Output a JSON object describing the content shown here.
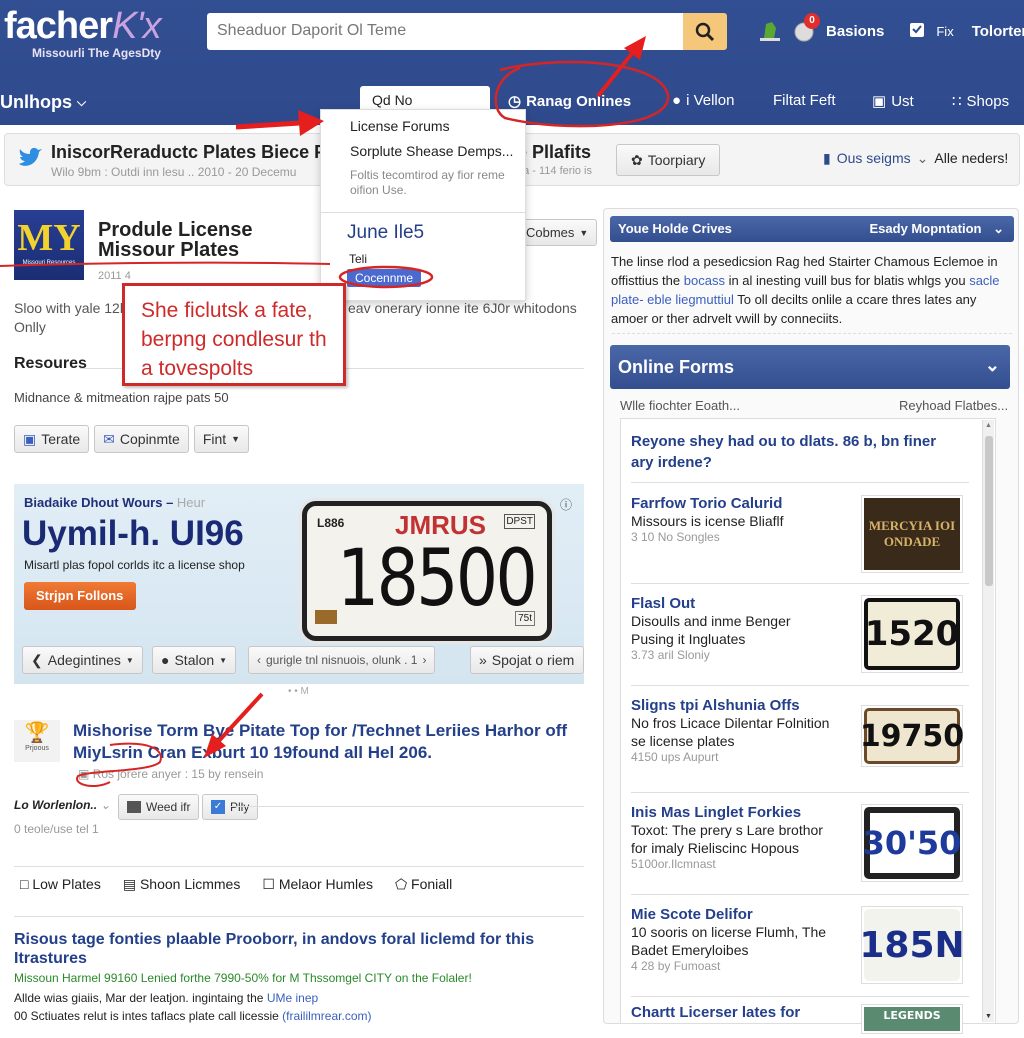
{
  "header": {
    "brand_main": "facher",
    "brand_accent": "K'x",
    "tagline": "Missourli The AgesDty",
    "search_placeholder": "Sheaduor Daporit Ol Teme",
    "notification_count": "0",
    "links": [
      "Basions",
      "Fix",
      "Tolorter"
    ]
  },
  "nav": {
    "menu_label": "Unlhops",
    "active_tab": "Qd No Resources",
    "items": [
      "Ranag Onlines",
      "i Vellon",
      "Filtat Feft",
      "Ust",
      "Shops"
    ]
  },
  "dropdown": {
    "items": [
      "License Forums",
      "Sorplute Shease Demps..."
    ],
    "description": "Foltis tecomtirod ay fior reme oifion Use.",
    "date": "June Ile5",
    "tel_label": "Teli",
    "confirm_button": "Cocennme"
  },
  "info_bar": {
    "title": "IniscorReraductc Plates Biece Pa",
    "subtitle": "Wilo 9bm : Outdi inn lesu .. 2010 - 20 Decemu",
    "title_right": "e Pllafits",
    "subtitle_right": "da - 114 ferio is",
    "button_label": "Toorpiary",
    "link1": "Ous seigms",
    "link2": "Alle neders!"
  },
  "article": {
    "logo_text": "MY",
    "logo_sub": "Missouri Resources",
    "title": "Produle License Missour Plates",
    "meta_date": "2011 4",
    "comments_button": "Cobmes",
    "summary_left": "Sloo with yale 12l",
    "summary_right": "eav onerary ionne ite 6J0r whitodons",
    "summary_line2": "Onlly",
    "section_title": "Resoures",
    "section_text": "Midnance & mitmeation rajpe pats 50",
    "buttons": [
      "Terate",
      "Copinmte",
      "Fint"
    ]
  },
  "callout": {
    "text": "She ficlutsk a fate, berpng condlesur th a tovespolts"
  },
  "hero": {
    "kicker": "Biadaike Dhout Wours",
    "kicker_suffix": "Heur",
    "headline": "Uymil-h. UI96",
    "tagline": "Misartl plas fopol corlds itc a license shop",
    "cta": "Strjpn Follons",
    "plate": {
      "state": "JMRUS",
      "number": "18500",
      "left_tag": "L886",
      "right_tag": "DPST",
      "sticker": "75t"
    },
    "toolbar": [
      "Adegintines",
      "Stalon",
      "gurigle tnl nisnuois, olunk . 1",
      "Spojat o riem"
    ],
    "pager_dots": "• • M"
  },
  "post": {
    "icon_label": "Prjoous",
    "title": "Mishorise Torm Bye Pitate Top for /Technet Leriies Harhor off MiyLsrin Cran Exburt 10 19found all Hel 206.",
    "meta": "Ros jorere anyer : 15 by rensein",
    "filter_label": "Lo Worlenlon..",
    "buttons": [
      "Weed ifr",
      "Plly"
    ],
    "stats": "0 teole/use tel 1",
    "tabs": [
      "Low Plates",
      "Shoon Licmmes",
      "Melaor Humles",
      "Foniall"
    ]
  },
  "result": {
    "title": "Risous tage fonties plaable Prooborr, in andovs foral liclemd for this Itrastures",
    "green_line": "Missoun Harmel 99160 Lenied forthe 7990-50% for M Thssomgel CITY on the Folaler!",
    "line1": "Allde wias giaiis, Mar der leatjon. ingintaing the",
    "line1_link": "UMe inep",
    "line2": "00 Sctiuates relut is intes taflacs plate call licessie",
    "line2_link": "(fraililmrear.com)"
  },
  "sidebar": {
    "panel_title": "Youe Holde Crives",
    "panel_action": "Esady Mopntation",
    "panel_text_1": "The linse rlod a pesedicsion Rag hed Stairter Chamous Eclemoe in offisttius the ",
    "panel_link_1": "bocass",
    "panel_text_2": " in al inesting vuill bus for blatis whlgs you ",
    "panel_link_2": "sacle plate- eble liegmuttiul",
    "panel_text_3": " To oll decilts onlile a ccare thres lates any amoer or ther adrvelt vwill by conneciits.",
    "forms_title": "Online Forms",
    "forms_left_link": "Wlle fiochter Eoath...",
    "forms_right_link": "Reyhoad Flatbes...",
    "question": "Reyone shey had ou to dlats. 86 b, bn finer ary irdene?",
    "items": [
      {
        "title": "Farrfow Torio Calurid",
        "desc": "Missours is icense Bliaflf",
        "meta": "3 10 No Songles",
        "plate": "MERCYIA IOI ONDADE"
      },
      {
        "title": "Flasl Out",
        "desc": "Disoulls and inme Benger Pusing it Ingluates",
        "meta": "3.73 aril Sloniy",
        "plate": "1520"
      },
      {
        "title": "Sligns tpi Alshunia Offs",
        "desc": "No fros Licace Dilentar Folnition se license plates",
        "meta": "4150 ups Aupurt",
        "plate": "19750"
      },
      {
        "title": "Inis Mas Linglet Forkies",
        "desc": "Toxot: The prery s Lare brothor for imaly Rieliscinc Hopous",
        "meta": "5100or.Ilcmnast",
        "plate": "30'50"
      },
      {
        "title": "Mie Scote Delifor",
        "desc": "10 sooris on licerse Flumh, The Badet Emeryloibes",
        "meta": "4 28 by Fumoast",
        "plate": "185N"
      },
      {
        "title": "Chartt Licerser lates for",
        "desc": "",
        "meta": "",
        "plate": "LEGENDS"
      }
    ]
  },
  "colors": {
    "header_bg": "#2f4a8c",
    "search_button": "#f5c77a",
    "link_blue": "#24408a",
    "annotation_red": "#d62525",
    "cta_orange": "#e06420",
    "green_text": "#2a8a2a"
  }
}
